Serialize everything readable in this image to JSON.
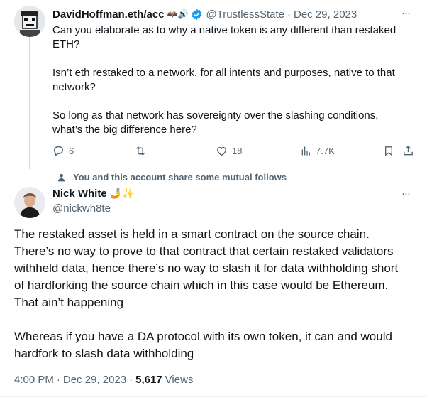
{
  "parent_tweet": {
    "display_name": "DavidHoffman.eth/acc",
    "display_name_emoji": "🦇🔊",
    "handle": "@TrustlessState",
    "separator": "·",
    "date": "Dec 29, 2023",
    "more": "···",
    "paragraphs": [
      "Can you elaborate as to why a native token is any different than restaked ETH?",
      "Isn’t eth restaked to a network, for all intents and purposes, native to that network?",
      "So long as that network has sovereignty over the slashing conditions, what’s the big difference here?"
    ],
    "actions": {
      "replies": "6",
      "retweets": "",
      "likes": "18",
      "views": "7.7K"
    }
  },
  "mutual_follows_notice": "You and this account share some mutual follows",
  "main_tweet": {
    "display_name": "Nick White",
    "display_name_emoji": "🤳✨",
    "handle": "@nickwh8te",
    "more": "···",
    "paragraphs": [
      "The restaked asset is held in a smart contract on the source chain. There’s no way to prove to that contract that certain restaked validators withheld data, hence there’s no way to slash it for data withholding short of hardforking the source chain which in this case would be Ethereum. That ain’t happening",
      "Whereas if you have a DA protocol with its own token, it can and would hardfork to slash data withholding"
    ],
    "time": "4:00 PM",
    "separator": "·",
    "date": "Dec 29, 2023",
    "views_count": "5,617",
    "views_label": "Views"
  },
  "colors": {
    "text": "#0f1419",
    "muted": "#536471",
    "verified": "#1d9bf0",
    "thread_line": "#cfd9de"
  },
  "icons": [
    "reply-icon",
    "retweet-icon",
    "like-icon",
    "views-icon",
    "bookmark-icon",
    "share-icon",
    "verified-badge-icon",
    "person-icon"
  ]
}
